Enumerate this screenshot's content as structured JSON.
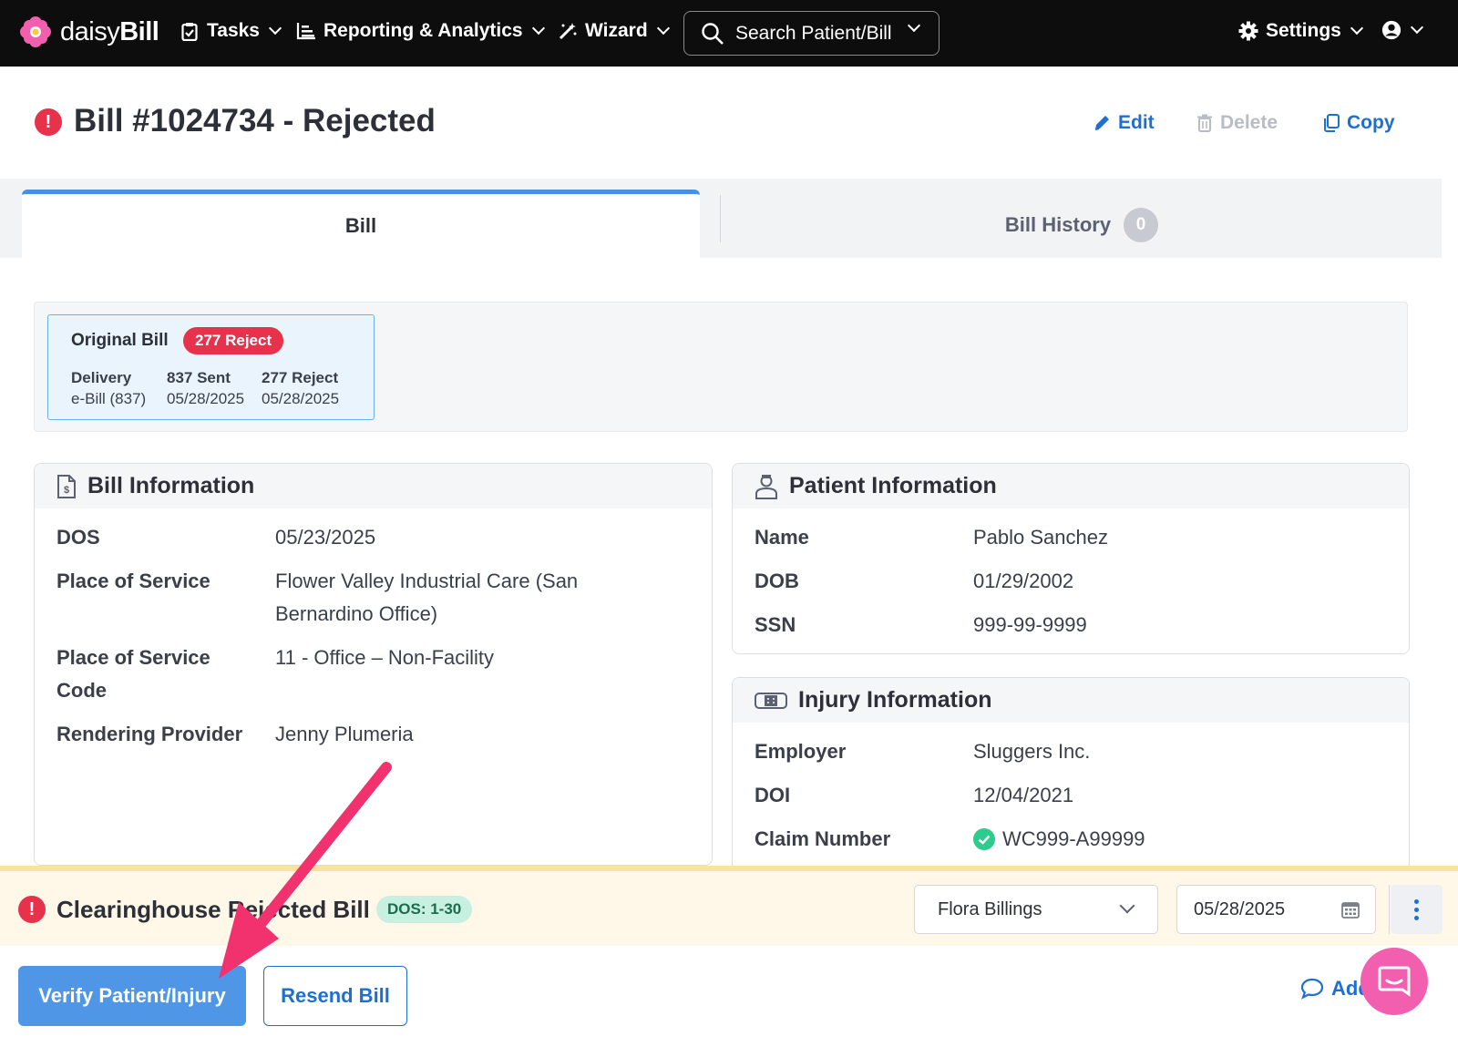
{
  "nav": {
    "logo_light": "daisy",
    "logo_bold": "Bill",
    "tasks": "Tasks",
    "reporting": "Reporting & Analytics",
    "wizard": "Wizard",
    "search_placeholder": "Search Patient/Bill",
    "settings": "Settings"
  },
  "header": {
    "title": "Bill #1024734 - Rejected",
    "edit": "Edit",
    "delete": "Delete",
    "copy": "Copy"
  },
  "tabs": {
    "bill": "Bill",
    "history": "Bill History",
    "history_count": "0"
  },
  "original_bill": {
    "title": "Original Bill",
    "status_badge": "277 Reject",
    "columns": [
      {
        "heading": "Delivery",
        "value": "e-Bill (837)"
      },
      {
        "heading": "837 Sent",
        "value": "05/28/2025"
      },
      {
        "heading": "277 Reject",
        "value": "05/28/2025"
      }
    ]
  },
  "bill_information": {
    "title": "Bill Information",
    "rows": [
      {
        "label": "DOS",
        "value": "05/23/2025"
      },
      {
        "label_line1": "Place of Service",
        "value_line1": "Flower Valley Industrial Care (San",
        "value_line2": "Bernardino Office)"
      },
      {
        "label_line1": "Place of Service",
        "label_line2": "Code",
        "value": "11 - Office – Non-Facility"
      },
      {
        "label": "Rendering Provider",
        "value": "Jenny Plumeria"
      }
    ]
  },
  "patient_information": {
    "title": "Patient Information",
    "rows": [
      {
        "label": "Name",
        "value": "Pablo Sanchez"
      },
      {
        "label": "DOB",
        "value": "01/29/2002"
      },
      {
        "label": "SSN",
        "value": "999-99-9999"
      }
    ]
  },
  "injury_information": {
    "title": "Injury Information",
    "rows": [
      {
        "label": "Employer",
        "value": "Sluggers Inc."
      },
      {
        "label": "DOI",
        "value": "12/04/2021"
      },
      {
        "label": "Claim Number",
        "value": "WC999-A99999"
      }
    ]
  },
  "rejection": {
    "title": "Clearinghouse Rejected Bill",
    "dos_badge": "DOS: 1-30",
    "assignee": "Flora Billings",
    "date": "05/28/2025"
  },
  "actions": {
    "verify": "Verify Patient/Injury",
    "resend": "Resend Bill",
    "add_note": "Add Note"
  },
  "colors": {
    "nav_bg": "#0d0d0d",
    "accent_blue": "#1f6fd1",
    "reject_red": "#e8324b",
    "primary_button": "#4f97e6",
    "warning_bg": "#fff8e8",
    "annotation_arrow": "#f2316f",
    "chat_pink": "#f25fae"
  }
}
